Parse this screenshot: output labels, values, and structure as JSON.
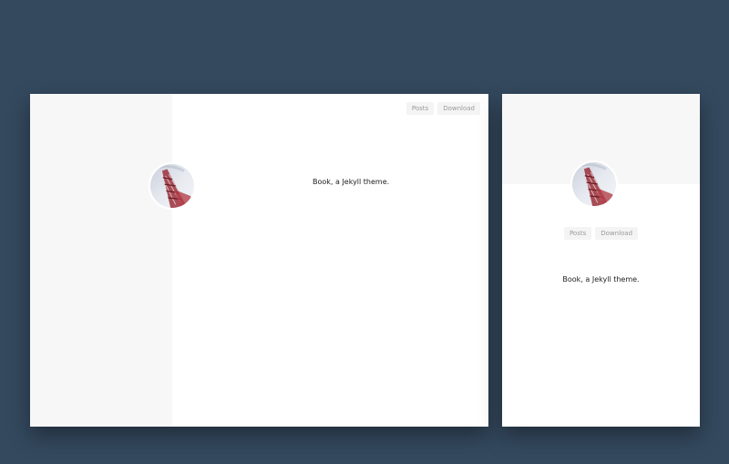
{
  "site": {
    "tagline": "Book, a Jekyll theme.",
    "avatar_icon": "tower-photo-icon"
  },
  "nav": {
    "posts_label": "Posts",
    "download_label": "Download"
  },
  "colors": {
    "background": "#34495e",
    "card": "#ffffff",
    "sidebar": "#f7f7f8",
    "button_bg": "#f4f4f4",
    "button_text": "#9a9a9a",
    "tower_red": "#a8323a",
    "sky": "#d9dee6"
  }
}
